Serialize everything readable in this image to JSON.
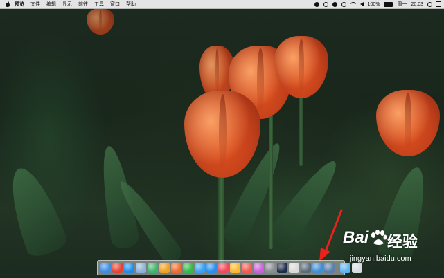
{
  "menubar": {
    "apple_icon": "apple-icon",
    "items": [
      "预览",
      "文件",
      "编辑",
      "显示",
      "前往",
      "工具",
      "窗口",
      "帮助"
    ],
    "status": {
      "day": "周一",
      "time": "20:03",
      "battery": "100%",
      "icons": [
        "screen-record-icon",
        "timemachine-icon",
        "info-icon",
        "bluetooth-icon",
        "wifi-icon",
        "volume-icon",
        "battery-icon",
        "spotlight-icon",
        "notification-list-icon"
      ]
    }
  },
  "dock": {
    "apps": [
      {
        "name": "finder",
        "color": "#3d8de0"
      },
      {
        "name": "chrome",
        "color": "#e54335"
      },
      {
        "name": "safari",
        "color": "#1f8ce8"
      },
      {
        "name": "preview-photo",
        "color": "#8bb2d6"
      },
      {
        "name": "clover-app",
        "color": "#44b36a"
      },
      {
        "name": "butterfly-app",
        "color": "#f0a021"
      },
      {
        "name": "qq-music",
        "color": "#ee6c2f"
      },
      {
        "name": "wechat",
        "color": "#36b84a"
      },
      {
        "name": "messages",
        "color": "#3aa1f0"
      },
      {
        "name": "app-store",
        "color": "#2b8fe9"
      },
      {
        "name": "music",
        "color": "#f04a5d"
      },
      {
        "name": "photos",
        "color": "#f8b830"
      },
      {
        "name": "calendar",
        "color": "#f25a4f"
      },
      {
        "name": "game-center",
        "color": "#c961d9"
      },
      {
        "name": "system-prefs",
        "color": "#8b8b94"
      },
      {
        "name": "dashboard",
        "color": "#1d2c4b"
      },
      {
        "name": "textedit",
        "color": "#d9d9d9"
      },
      {
        "name": "font-book",
        "color": "#5a6b7a"
      },
      {
        "name": "airplane-app",
        "color": "#3f8fd6"
      },
      {
        "name": "display-app",
        "color": "#5a7fa8"
      }
    ],
    "right": [
      {
        "name": "downloads-folder",
        "color": "#5fb3ef"
      },
      {
        "name": "trash",
        "color": "#d8dce0"
      }
    ]
  },
  "watermark": {
    "brand": "Bai",
    "brand_cn": "经验",
    "url": "jingyan.baidu.com"
  }
}
